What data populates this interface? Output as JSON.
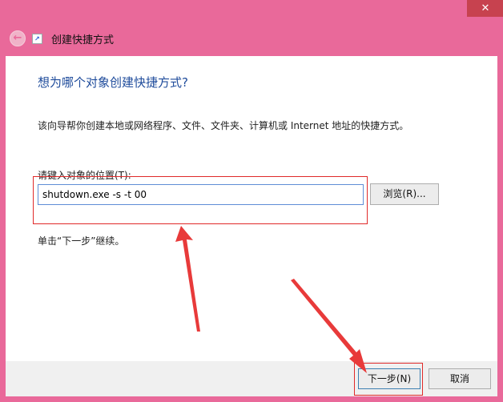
{
  "window": {
    "close_glyph": "✕",
    "back_glyph": "←",
    "title": "创建快捷方式"
  },
  "content": {
    "heading": "想为哪个对象创建快捷方式?",
    "description": "该向导帮你创建本地或网络程序、文件、文件夹、计算机或 Internet 地址的快捷方式。",
    "location_label": "请键入对象的位置(T):",
    "location_value": "shutdown.exe -s -t 00",
    "browse_label": "浏览(R)...",
    "hint": "单击“下一步”继续。"
  },
  "footer": {
    "next_label": "下一步(N)",
    "cancel_label": "取消"
  },
  "colors": {
    "frame": "#e9699a",
    "annotation": "#e02a2a",
    "heading": "#1e4b9b"
  }
}
